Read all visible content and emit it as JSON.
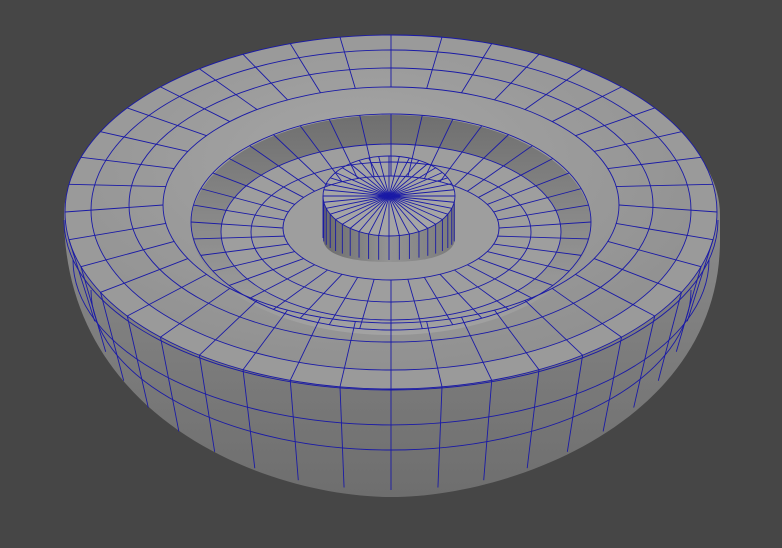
{
  "viewport": {
    "background": "#464646",
    "shading": "smooth-gray",
    "wireframe_on_shaded": true,
    "wireframe_color": "#1a1aa6"
  },
  "mesh": {
    "type": "polygon-mesh",
    "shape": "revolved-disc-with-inner-bowl-and-center-boss",
    "radial_segments": 40
  }
}
